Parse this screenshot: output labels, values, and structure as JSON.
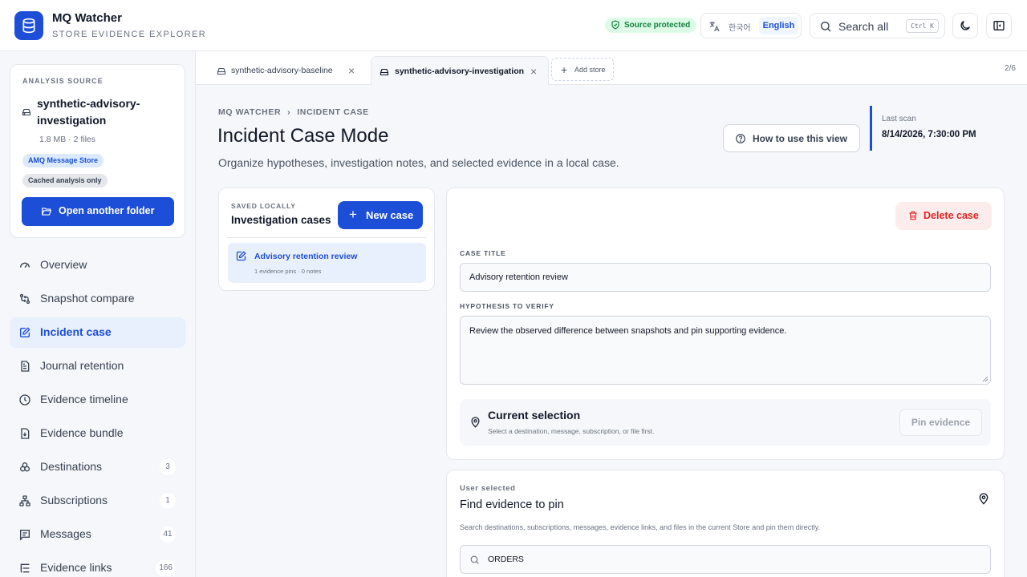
{
  "app": {
    "name": "MQ Watcher",
    "subtitle": "STORE EVIDENCE EXPLORER"
  },
  "header": {
    "source_badge": "Source protected",
    "lang_ko": "한국어",
    "lang_en": "English",
    "search_label": "Search all",
    "search_shortcut": "Ctrl K"
  },
  "source_card": {
    "heading": "ANALYSIS SOURCE",
    "name": "synthetic-advisory-investigation",
    "meta": "1.8 MB · 2 files",
    "tag_type": "AMQ Message Store",
    "tag_mode": "Cached analysis only",
    "open_button": "Open another folder"
  },
  "nav": [
    {
      "label": "Overview",
      "icon": "gauge-icon",
      "count": null,
      "active": false
    },
    {
      "label": "Snapshot compare",
      "icon": "compare-icon",
      "count": null,
      "active": false
    },
    {
      "label": "Incident case",
      "icon": "edit-case-icon",
      "count": null,
      "active": true
    },
    {
      "label": "Journal retention",
      "icon": "journal-icon",
      "count": null,
      "active": false
    },
    {
      "label": "Evidence timeline",
      "icon": "clock-icon",
      "count": null,
      "active": false
    },
    {
      "label": "Evidence bundle",
      "icon": "download-file-icon",
      "count": null,
      "active": false
    },
    {
      "label": "Destinations",
      "icon": "boxes-icon",
      "count": "3",
      "active": false
    },
    {
      "label": "Subscriptions",
      "icon": "network-icon",
      "count": "1",
      "active": false
    },
    {
      "label": "Messages",
      "icon": "message-icon",
      "count": "41",
      "active": false
    },
    {
      "label": "Evidence links",
      "icon": "list-tree-icon",
      "count": "166",
      "active": false
    }
  ],
  "tabs": [
    {
      "label": "synthetic-advisory-baseline",
      "active": false
    },
    {
      "label": "synthetic-advisory-investigation",
      "active": true
    }
  ],
  "add_store": "Add store",
  "tab_count": "2/6",
  "breadcrumb": {
    "root": "MQ WATCHER",
    "current": "INCIDENT CASE"
  },
  "page": {
    "title": "Incident Case Mode",
    "description": "Organize hypotheses, investigation notes, and selected evidence in a local case.",
    "howto_button": "How to use this view",
    "last_scan_label": "Last scan",
    "last_scan_value": "8/14/2026, 7:30:00 PM"
  },
  "cases_panel": {
    "kicker": "SAVED LOCALLY",
    "title": "Investigation cases",
    "new_button": "New case",
    "items": [
      {
        "title": "Advisory retention review",
        "meta": "1 evidence pins · 0 notes"
      }
    ]
  },
  "editor": {
    "delete_button": "Delete case",
    "case_title_label": "CASE TITLE",
    "case_title_value": "Advisory retention review",
    "hypothesis_label": "HYPOTHESIS TO VERIFY",
    "hypothesis_value": "Review the observed difference between snapshots and pin supporting evidence.",
    "current_selection_title": "Current selection",
    "current_selection_sub": "Select a destination, message, subscription, or file first.",
    "pin_button": "Pin evidence"
  },
  "finder": {
    "kicker": "User selected",
    "title": "Find evidence to pin",
    "description": "Search destinations, subscriptions, messages, evidence links, and files in the current Store and pin them directly.",
    "query": "ORDERS"
  },
  "colors": {
    "accent": "#1d4ed8",
    "danger": "#dc2626",
    "success": "#15803d"
  }
}
